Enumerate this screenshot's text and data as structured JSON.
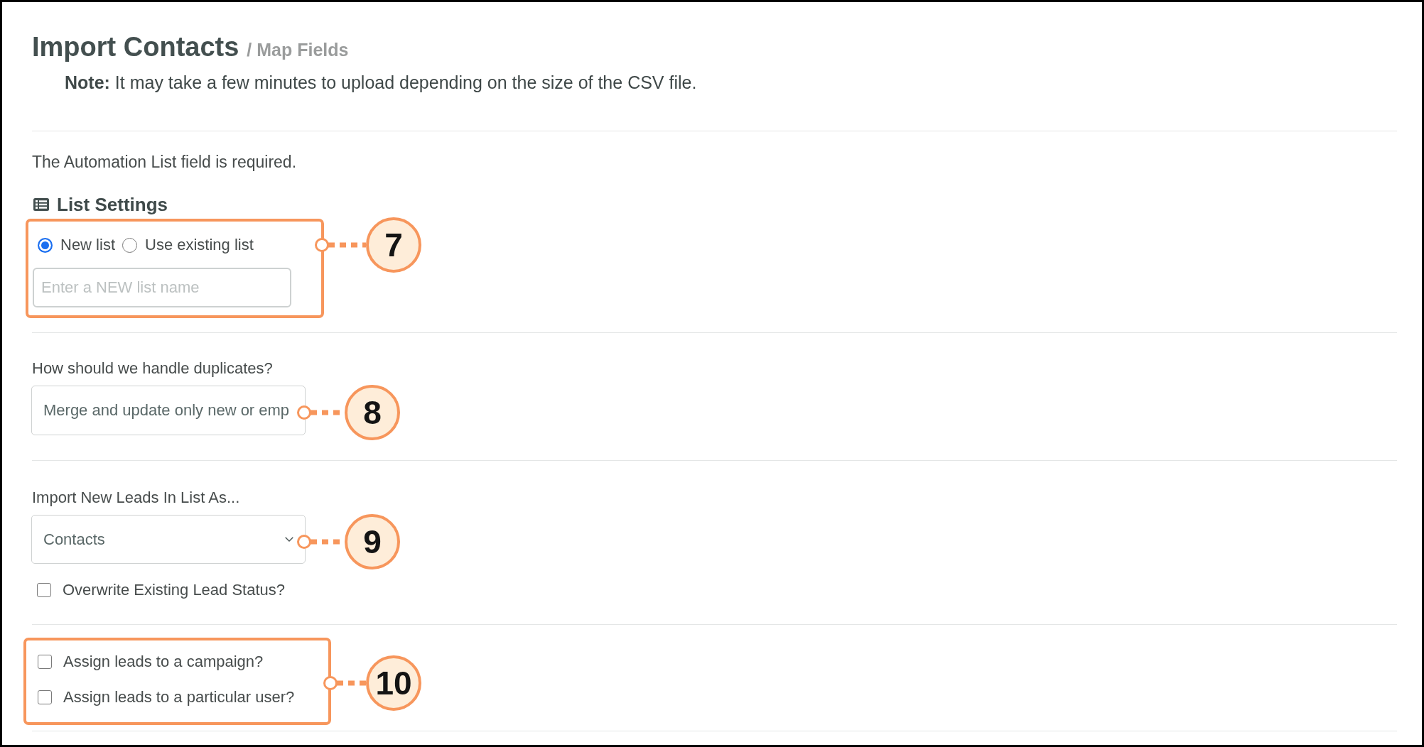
{
  "header": {
    "title": "Import Contacts",
    "breadcrumb": "/ Map Fields",
    "note": "**Note:** It may take a few minutes to upload depending on the size of the CSV file."
  },
  "validation_message": "The Automation List field is required.",
  "list_settings": {
    "heading": "List Settings",
    "options": [
      {
        "label": "New list",
        "selected": true
      },
      {
        "label": "Use existing list",
        "selected": false
      }
    ],
    "list_name": {
      "placeholder": "Enter a NEW list name"
    },
    "callout": {
      "number": "7",
      "framed": true
    }
  },
  "duplicates": {
    "label": "How should we handle duplicates?",
    "value": "Merge and update only new or emp",
    "callout": {
      "number": "8"
    }
  },
  "import_as": {
    "label": "Import New Leads In List As...",
    "value": "Contacts",
    "callout": {
      "number": "9"
    },
    "overwrite_status": {
      "label": "Overwrite Existing Lead Status?",
      "checked": false
    }
  },
  "assignment": {
    "options": [
      {
        "label": "Assign leads to a campaign?",
        "checked": false
      },
      {
        "label": "Assign leads to a particular user?",
        "checked": false
      }
    ],
    "callout": {
      "number": "10",
      "framed": true
    }
  }
}
